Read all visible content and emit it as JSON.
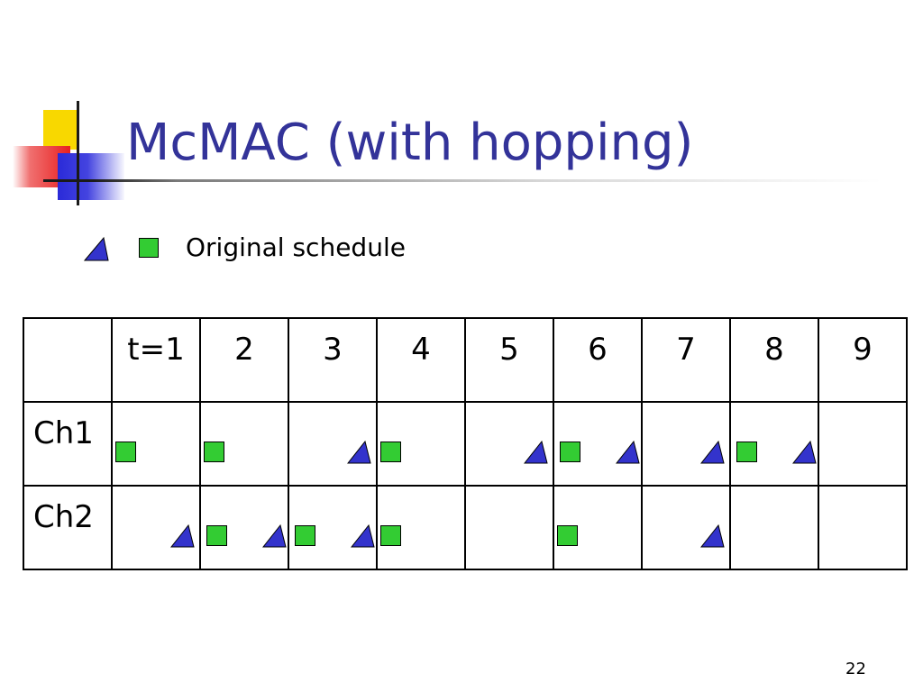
{
  "title": "McMAC (with hopping)",
  "legend": {
    "label": "Original schedule",
    "icons": [
      "triangle-icon",
      "square-icon"
    ]
  },
  "colors": {
    "title": "#333399",
    "triangle_fill": "#3333cc",
    "square_fill": "#33cc33",
    "logo_yellow": "#f8d800",
    "logo_red": "#e82020",
    "logo_blue": "#2a2ad8"
  },
  "table": {
    "header": [
      "",
      "t=1",
      "2",
      "3",
      "4",
      "5",
      "6",
      "7",
      "8",
      "9"
    ],
    "rows": [
      {
        "label": "Ch1",
        "cells": [
          [
            "square"
          ],
          [
            "square"
          ],
          [
            "triangle"
          ],
          [
            "square"
          ],
          [
            "triangle"
          ],
          [
            "triangle",
            "square"
          ],
          [
            "triangle"
          ],
          [
            "triangle",
            "square"
          ],
          []
        ]
      },
      {
        "label": "Ch2",
        "cells": [
          [
            "triangle"
          ],
          [
            "triangle",
            "square"
          ],
          [
            "triangle",
            "square"
          ],
          [
            "square"
          ],
          [],
          [
            "square"
          ],
          [
            "triangle"
          ],
          [],
          []
        ]
      }
    ]
  },
  "page_number": "22"
}
